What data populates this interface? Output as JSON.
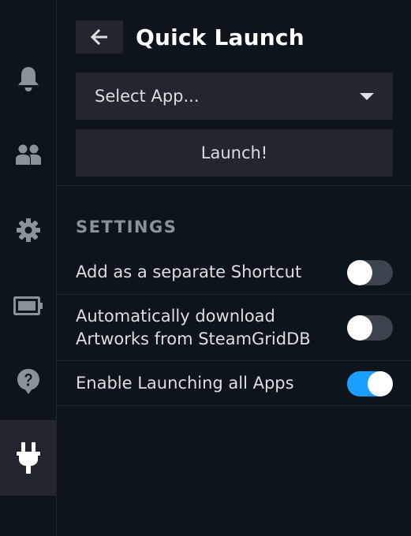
{
  "rail": {
    "items": [
      {
        "icon": "bell-icon",
        "active": false
      },
      {
        "icon": "friends-icon",
        "active": false
      },
      {
        "icon": "gear-icon",
        "active": false
      },
      {
        "icon": "battery-icon",
        "active": false
      },
      {
        "icon": "help-icon",
        "active": false
      },
      {
        "icon": "plug-icon",
        "active": true
      }
    ]
  },
  "header": {
    "back_icon": "arrow-left-icon",
    "title": "Quick Launch"
  },
  "app_select": {
    "value": "Select App...",
    "arrow_icon": "caret-down-icon"
  },
  "launch_button": {
    "label": "Launch!"
  },
  "settings": {
    "title": "SETTINGS",
    "options": [
      {
        "line1": "Add as a separate Shortcut",
        "line2": "",
        "enabled": false
      },
      {
        "line1": "Automatically download",
        "line2": "Artworks from SteamGridDB",
        "enabled": false
      },
      {
        "line1": "Enable Launching all Apps",
        "line2": "",
        "enabled": true
      }
    ]
  },
  "colors": {
    "background": "#0e141b",
    "control": "#23262e",
    "accent": "#1a9fff",
    "text": "#dcdedf",
    "muted": "#8b929a",
    "icon": "#8b929a"
  }
}
